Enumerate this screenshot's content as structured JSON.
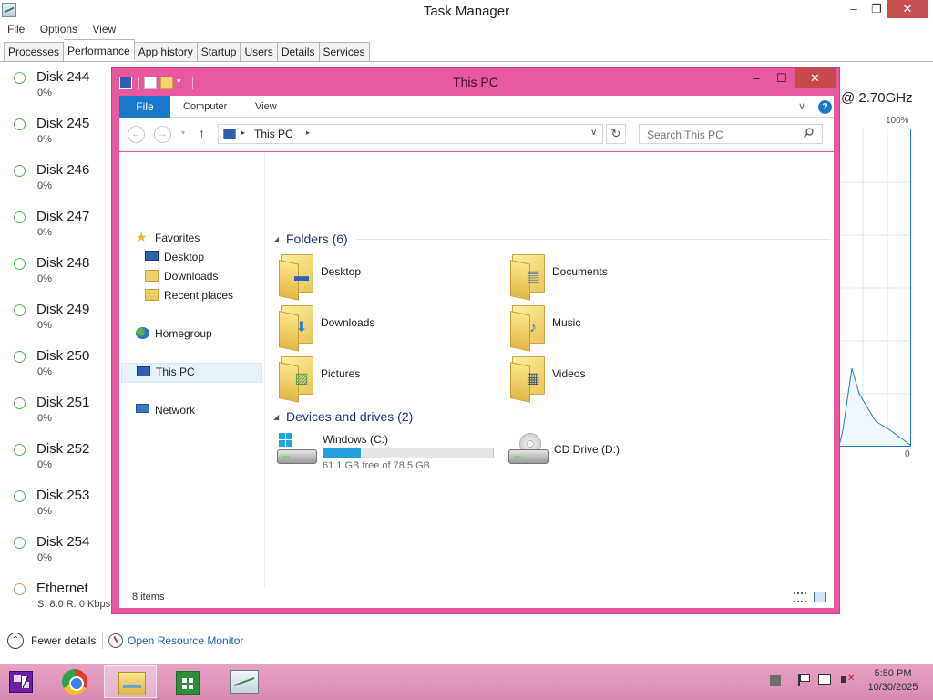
{
  "task_manager": {
    "title": "Task Manager",
    "caption_buttons": {
      "minimize": "–",
      "maximize": "❐",
      "close": "✕"
    },
    "menu": [
      "File",
      "Options",
      "View"
    ],
    "tabs": [
      "Processes",
      "Performance",
      "App history",
      "Startup",
      "Users",
      "Details",
      "Services"
    ],
    "active_tab": "Performance",
    "disks": [
      {
        "name": "Disk 244",
        "value": "0%"
      },
      {
        "name": "Disk 245",
        "value": "0%"
      },
      {
        "name": "Disk 246",
        "value": "0%"
      },
      {
        "name": "Disk 247",
        "value": "0%"
      },
      {
        "name": "Disk 248",
        "value": "0%"
      },
      {
        "name": "Disk 249",
        "value": "0%"
      },
      {
        "name": "Disk 250",
        "value": "0%"
      },
      {
        "name": "Disk 251",
        "value": "0%"
      },
      {
        "name": "Disk 252",
        "value": "0%"
      },
      {
        "name": "Disk 253",
        "value": "0%"
      },
      {
        "name": "Disk 254",
        "value": "0%"
      },
      {
        "name": "Ethernet",
        "value": "S: 8.0  R: 0 Kbps"
      }
    ],
    "cpu_speed": "@ 2.70GHz",
    "graph_max_label": "100%",
    "graph_min_label": "0",
    "fewer_details": "Fewer details",
    "open_resource_monitor": "Open Resource Monitor",
    "colors": {
      "disk_ring": "#52b352",
      "ethernet_ring": "#d49568",
      "graph_line": "#1f7fbf"
    }
  },
  "explorer": {
    "title": "This PC",
    "caption_buttons": {
      "minimize": "–",
      "maximize": "☐",
      "close": "✕"
    },
    "qat_overflow": "▾",
    "ribbon": {
      "file": "File",
      "tabs": [
        "Computer",
        "View"
      ],
      "expand": "∨",
      "help": "?"
    },
    "nav_buttons": {
      "back": "←",
      "forward": "→",
      "recent": "▾",
      "up": "↑"
    },
    "address": {
      "location": "This PC",
      "separator": "▸",
      "dropdown": "∨",
      "refresh": "↻"
    },
    "search": {
      "placeholder": "Search This PC"
    },
    "nav_pane": [
      {
        "label": "Favorites",
        "icon": "star-icon"
      },
      {
        "label": "Desktop",
        "icon": "desktop-icon"
      },
      {
        "label": "Downloads",
        "icon": "downloads-icon"
      },
      {
        "label": "Recent places",
        "icon": "recent-places-icon"
      },
      {
        "label": "Homegroup",
        "icon": "homegroup-icon"
      },
      {
        "label": "This PC",
        "icon": "this-pc-icon",
        "selected": true
      },
      {
        "label": "Network",
        "icon": "network-icon"
      }
    ],
    "groups": {
      "folders": {
        "caret": "◢",
        "label": "Folders (6)"
      },
      "devices": {
        "caret": "◢",
        "label": "Devices and drives (2)"
      }
    },
    "folders": [
      {
        "label": "Desktop",
        "icon": "desktop-folder-icon",
        "badge": "▬"
      },
      {
        "label": "Documents",
        "icon": "documents-folder-icon",
        "badge": "▤"
      },
      {
        "label": "Downloads",
        "icon": "downloads-folder-icon",
        "badge": "⬇"
      },
      {
        "label": "Music",
        "icon": "music-folder-icon",
        "badge": "♪"
      },
      {
        "label": "Pictures",
        "icon": "pictures-folder-icon",
        "badge": "▨"
      },
      {
        "label": "Videos",
        "icon": "videos-folder-icon",
        "badge": "▦"
      }
    ],
    "drives": [
      {
        "label": "Windows (C:)",
        "free_text": "61.1 GB free of 78.5 GB",
        "used_fraction": 0.222,
        "icon": "hard-drive-icon"
      },
      {
        "label": "CD Drive (D:)",
        "icon": "cd-drive-icon"
      }
    ],
    "status": {
      "items": "8 items"
    },
    "colors": {
      "frame": "#e8589e",
      "ribbon_file": "#1979ca",
      "group_header": "#1e3287",
      "drive_bar": "#26a0da"
    }
  },
  "taskbar": {
    "apps": [
      {
        "name": "chrome",
        "active": false
      },
      {
        "name": "file-explorer",
        "active": true
      },
      {
        "name": "store",
        "active": false
      },
      {
        "name": "task-manager",
        "active": false
      }
    ],
    "clock": {
      "time": "5:50 PM",
      "date": "10/30/2025"
    },
    "colors": {
      "background": "#e09ac0",
      "start": "#6a1fa6"
    }
  }
}
